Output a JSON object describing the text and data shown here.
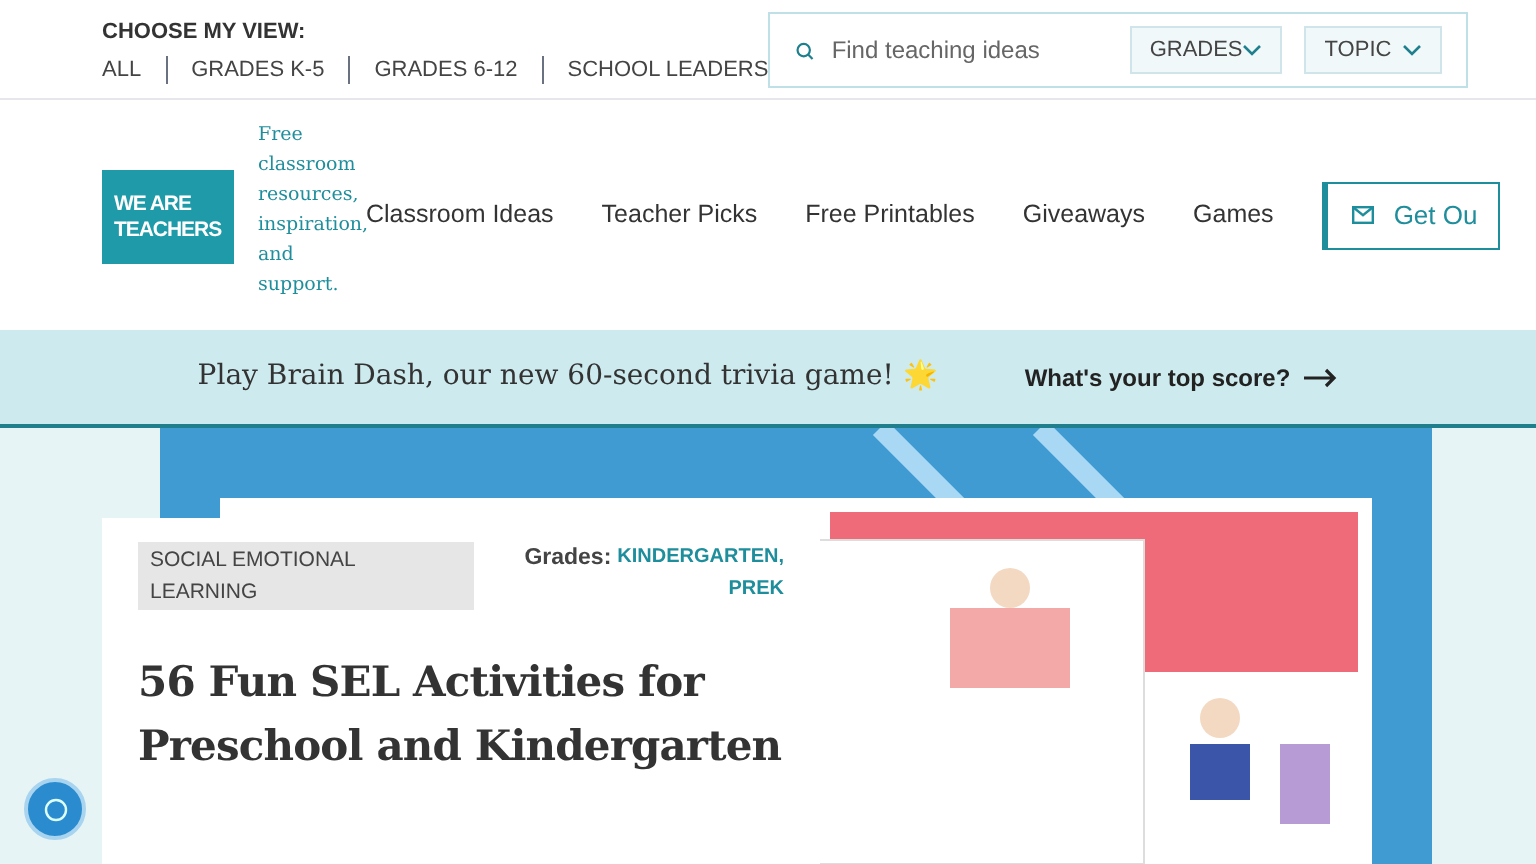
{
  "view_chooser": {
    "label": "CHOOSE MY VIEW:",
    "options": [
      "ALL",
      "GRADES K-5",
      "GRADES 6-12",
      "SCHOOL LEADERS"
    ]
  },
  "search": {
    "placeholder": "Find teaching ideas",
    "filters": [
      "GRADES",
      "TOPIC"
    ]
  },
  "logo": {
    "lines": [
      "WE ARE",
      "TEACHERS"
    ],
    "tagline": "Free classroom resources, inspiration, and support."
  },
  "nav": {
    "items": [
      "Classroom Ideas",
      "Teacher Picks",
      "Free Printables",
      "Giveaways",
      "Games"
    ],
    "cta": "Get Ou"
  },
  "promo": {
    "text": "Play Brain Dash, our new 60-second trivia game! 🌟",
    "link": "What's your top score?"
  },
  "article": {
    "category": "SOCIAL EMOTIONAL LEARNING",
    "grades_label": "Grades:",
    "grades": [
      "KINDERGARTEN,",
      "PREK"
    ],
    "title": "56 Fun SEL Activities for Preschool and Kindergarten"
  }
}
